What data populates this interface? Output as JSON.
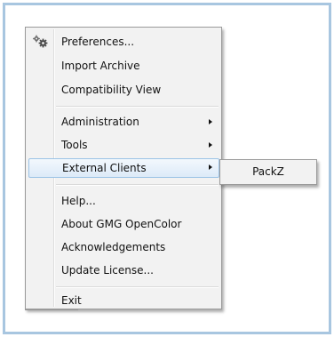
{
  "menu": {
    "groups": [
      [
        {
          "label": "Preferences...",
          "icon": "gear-icon"
        },
        {
          "label": "Import Archive"
        },
        {
          "label": "Compatibility View"
        }
      ],
      [
        {
          "label": "Administration",
          "submenu": true
        },
        {
          "label": "Tools",
          "submenu": true
        },
        {
          "label": "External Clients",
          "submenu": true,
          "highlighted": true
        }
      ],
      [
        {
          "label": "Help..."
        },
        {
          "label": "About GMG OpenColor"
        },
        {
          "label": "Acknowledgements"
        },
        {
          "label": "Update License..."
        }
      ],
      [
        {
          "label": "Exit"
        }
      ]
    ]
  },
  "submenu": {
    "items": [
      {
        "label": "PackZ"
      }
    ]
  },
  "colors": {
    "frame_border": "#a8c6e0",
    "menu_background": "#f2f2f2",
    "highlight_border": "#9cc3e6",
    "highlight_fill": "#dceaf8"
  }
}
